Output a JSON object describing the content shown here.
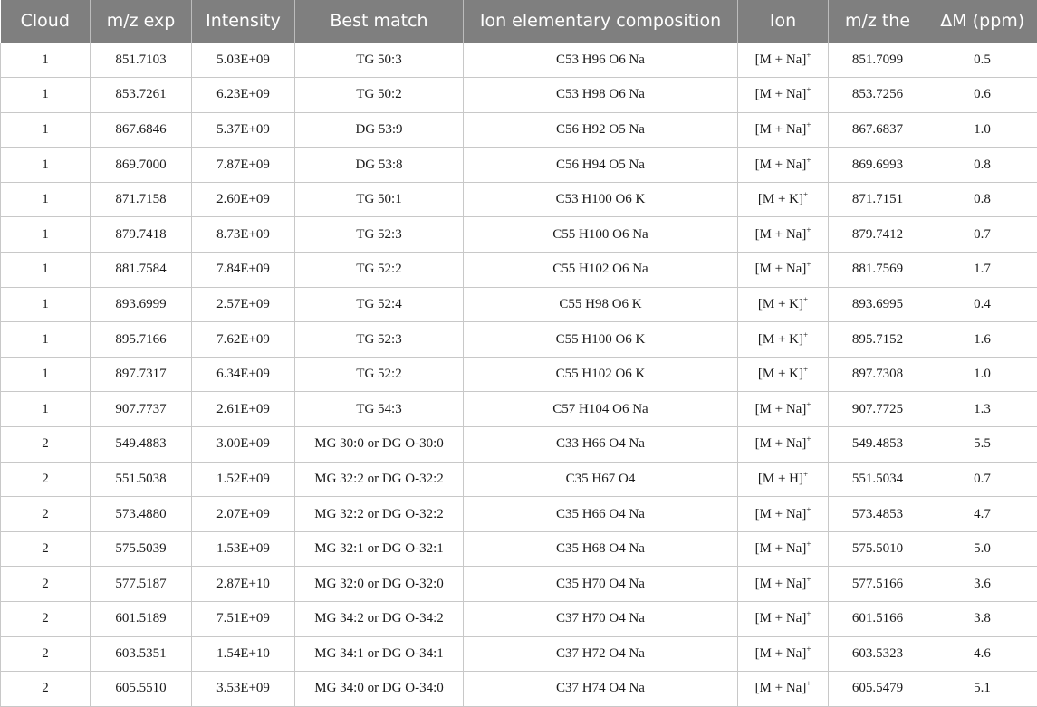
{
  "table": {
    "headers": [
      "Cloud",
      "m/z exp",
      "Intensity",
      "Best match",
      "Ion elementary composition",
      "Ion",
      "m/z the",
      "ΔM (ppm)"
    ],
    "rows": [
      {
        "cloud": "1",
        "mz_exp": "851.7103",
        "intensity": "5.03E+09",
        "best_match": "TG 50:3",
        "composition": "C53 H96 O6 Na",
        "ion": "[M + Na]",
        "ion_charge": "+",
        "mz_the": "851.7099",
        "delta_m": "0.5"
      },
      {
        "cloud": "1",
        "mz_exp": "853.7261",
        "intensity": "6.23E+09",
        "best_match": "TG 50:2",
        "composition": "C53 H98 O6 Na",
        "ion": "[M + Na]",
        "ion_charge": "+",
        "mz_the": "853.7256",
        "delta_m": "0.6"
      },
      {
        "cloud": "1",
        "mz_exp": "867.6846",
        "intensity": "5.37E+09",
        "best_match": "DG 53:9",
        "composition": "C56 H92 O5 Na",
        "ion": "[M + Na]",
        "ion_charge": "+",
        "mz_the": "867.6837",
        "delta_m": "1.0"
      },
      {
        "cloud": "1",
        "mz_exp": "869.7000",
        "intensity": "7.87E+09",
        "best_match": "DG 53:8",
        "composition": "C56 H94 O5 Na",
        "ion": "[M + Na]",
        "ion_charge": "+",
        "mz_the": "869.6993",
        "delta_m": "0.8"
      },
      {
        "cloud": "1",
        "mz_exp": "871.7158",
        "intensity": "2.60E+09",
        "best_match": "TG 50:1",
        "composition": "C53 H100 O6 K",
        "ion": "[M + K]",
        "ion_charge": "+",
        "mz_the": "871.7151",
        "delta_m": "0.8"
      },
      {
        "cloud": "1",
        "mz_exp": "879.7418",
        "intensity": "8.73E+09",
        "best_match": "TG 52:3",
        "composition": "C55 H100 O6 Na",
        "ion": "[M + Na]",
        "ion_charge": "+",
        "mz_the": "879.7412",
        "delta_m": "0.7"
      },
      {
        "cloud": "1",
        "mz_exp": "881.7584",
        "intensity": "7.84E+09",
        "best_match": "TG 52:2",
        "composition": "C55 H102 O6 Na",
        "ion": "[M + Na]",
        "ion_charge": "+",
        "mz_the": "881.7569",
        "delta_m": "1.7"
      },
      {
        "cloud": "1",
        "mz_exp": "893.6999",
        "intensity": "2.57E+09",
        "best_match": "TG 52:4",
        "composition": "C55 H98 O6 K",
        "ion": "[M + K]",
        "ion_charge": "+",
        "mz_the": "893.6995",
        "delta_m": "0.4"
      },
      {
        "cloud": "1",
        "mz_exp": "895.7166",
        "intensity": "7.62E+09",
        "best_match": "TG 52:3",
        "composition": "C55 H100 O6 K",
        "ion": "[M + K]",
        "ion_charge": "+",
        "mz_the": "895.7152",
        "delta_m": "1.6"
      },
      {
        "cloud": "1",
        "mz_exp": "897.7317",
        "intensity": "6.34E+09",
        "best_match": "TG 52:2",
        "composition": "C55 H102 O6 K",
        "ion": "[M + K]",
        "ion_charge": "+",
        "mz_the": "897.7308",
        "delta_m": "1.0"
      },
      {
        "cloud": "1",
        "mz_exp": "907.7737",
        "intensity": "2.61E+09",
        "best_match": "TG 54:3",
        "composition": "C57 H104 O6 Na",
        "ion": "[M + Na]",
        "ion_charge": "+",
        "mz_the": "907.7725",
        "delta_m": "1.3"
      },
      {
        "cloud": "2",
        "mz_exp": "549.4883",
        "intensity": "3.00E+09",
        "best_match": "MG 30:0 or DG O-30:0",
        "composition": "C33 H66 O4 Na",
        "ion": "[M + Na]",
        "ion_charge": "+",
        "mz_the": "549.4853",
        "delta_m": "5.5"
      },
      {
        "cloud": "2",
        "mz_exp": "551.5038",
        "intensity": "1.52E+09",
        "best_match": "MG 32:2 or DG O-32:2",
        "composition": "C35 H67 O4",
        "ion": "[M + H]",
        "ion_charge": "+",
        "mz_the": "551.5034",
        "delta_m": "0.7"
      },
      {
        "cloud": "2",
        "mz_exp": "573.4880",
        "intensity": "2.07E+09",
        "best_match": "MG 32:2 or DG O-32:2",
        "composition": "C35 H66 O4 Na",
        "ion": "[M + Na]",
        "ion_charge": "+",
        "mz_the": "573.4853",
        "delta_m": "4.7"
      },
      {
        "cloud": "2",
        "mz_exp": "575.5039",
        "intensity": "1.53E+09",
        "best_match": "MG 32:1 or DG O-32:1",
        "composition": "C35 H68 O4 Na",
        "ion": "[M + Na]",
        "ion_charge": "+",
        "mz_the": "575.5010",
        "delta_m": "5.0"
      },
      {
        "cloud": "2",
        "mz_exp": "577.5187",
        "intensity": "2.87E+10",
        "best_match": "MG 32:0 or DG O-32:0",
        "composition": "C35 H70 O4 Na",
        "ion": "[M + Na]",
        "ion_charge": "+",
        "mz_the": "577.5166",
        "delta_m": "3.6"
      },
      {
        "cloud": "2",
        "mz_exp": "601.5189",
        "intensity": "7.51E+09",
        "best_match": "MG 34:2 or DG O-34:2",
        "composition": "C37 H70 O4 Na",
        "ion": "[M + Na]",
        "ion_charge": "+",
        "mz_the": "601.5166",
        "delta_m": "3.8"
      },
      {
        "cloud": "2",
        "mz_exp": "603.5351",
        "intensity": "1.54E+10",
        "best_match": "MG 34:1 or DG O-34:1",
        "composition": "C37 H72 O4 Na",
        "ion": "[M + Na]",
        "ion_charge": "+",
        "mz_the": "603.5323",
        "delta_m": "4.6"
      },
      {
        "cloud": "2",
        "mz_exp": "605.5510",
        "intensity": "3.53E+09",
        "best_match": "MG 34:0 or DG O-34:0",
        "composition": "C37 H74 O4 Na",
        "ion": "[M + Na]",
        "ion_charge": "+",
        "mz_the": "605.5479",
        "delta_m": "5.1"
      }
    ]
  }
}
